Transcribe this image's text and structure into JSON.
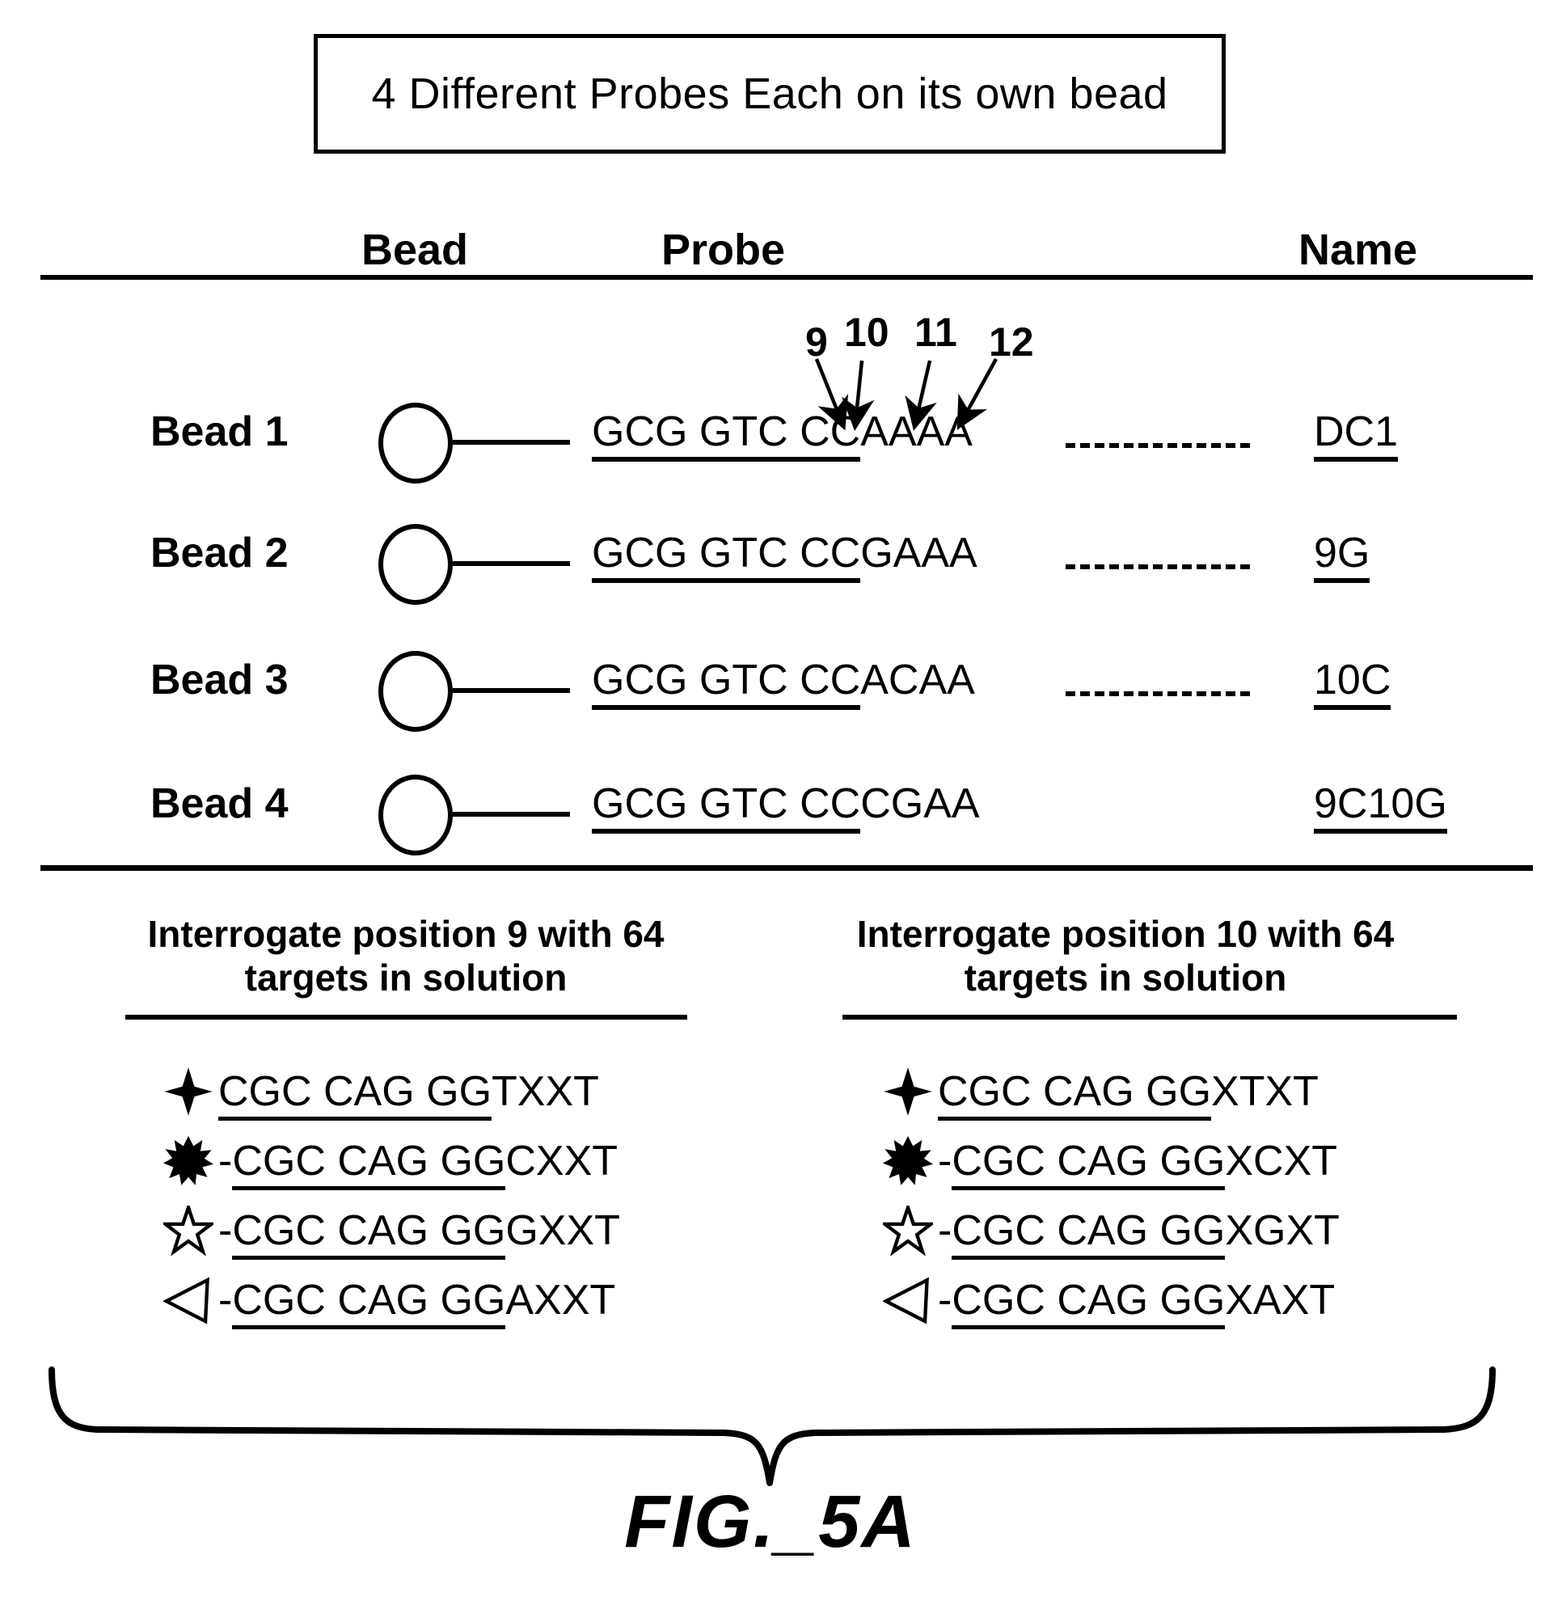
{
  "title_box": {
    "text": "4 Different Probes Each on its own bead"
  },
  "table": {
    "headers": {
      "bead": "Bead",
      "probe": "Probe",
      "name": "Name"
    },
    "position_callouts": [
      {
        "label": "9"
      },
      {
        "label": "10"
      },
      {
        "label": "11"
      },
      {
        "label": "12"
      }
    ],
    "rows": [
      {
        "bead_label": "Bead 1",
        "probe_constant": "GCG GTC CC",
        "probe_variable": "AAAA",
        "has_dash_line": true,
        "name": "DC1"
      },
      {
        "bead_label": "Bead 2",
        "probe_constant": "GCG GTC CC",
        "probe_variable": "GAAA",
        "has_dash_line": true,
        "name": "9G"
      },
      {
        "bead_label": "Bead 3",
        "probe_constant": "GCG GTC CC",
        "probe_variable": "ACAA",
        "has_dash_line": true,
        "name": "10C"
      },
      {
        "bead_label": "Bead 4",
        "probe_constant": "GCG GTC CC",
        "probe_variable": "CGAA",
        "has_dash_line": false,
        "name": "9C10G"
      }
    ]
  },
  "panels": [
    {
      "title_line1": "Interrogate position 9 with 64",
      "title_line2": "targets in solution",
      "targets": [
        {
          "icon": "sparkle-star-icon",
          "dash": "",
          "constant": "CGC CAG GG",
          "variable": "TXXT"
        },
        {
          "icon": "starburst-icon",
          "dash": "-",
          "constant": "CGC CAG GG",
          "variable": "CXXT"
        },
        {
          "icon": "five-point-star-icon",
          "dash": "-",
          "constant": "CGC CAG GG",
          "variable": "GXXT"
        },
        {
          "icon": "left-triangle-icon",
          "dash": "-",
          "constant": "CGC CAG GG",
          "variable": "AXXT"
        }
      ]
    },
    {
      "title_line1": "Interrogate position 10 with 64",
      "title_line2": "targets in solution",
      "targets": [
        {
          "icon": "sparkle-star-icon",
          "dash": "",
          "constant": "CGC CAG GG",
          "variable": "XTXT"
        },
        {
          "icon": "starburst-icon",
          "dash": "-",
          "constant": "CGC CAG GG",
          "variable": "XCXT"
        },
        {
          "icon": "five-point-star-icon",
          "dash": "-",
          "constant": "CGC CAG GG",
          "variable": "XGXT"
        },
        {
          "icon": "left-triangle-icon",
          "dash": "-",
          "constant": "CGC CAG GG",
          "variable": "XAXT"
        }
      ]
    }
  ],
  "figure_caption": "FIG._5A",
  "colors": {
    "ink": "#000000",
    "paper": "#ffffff"
  }
}
